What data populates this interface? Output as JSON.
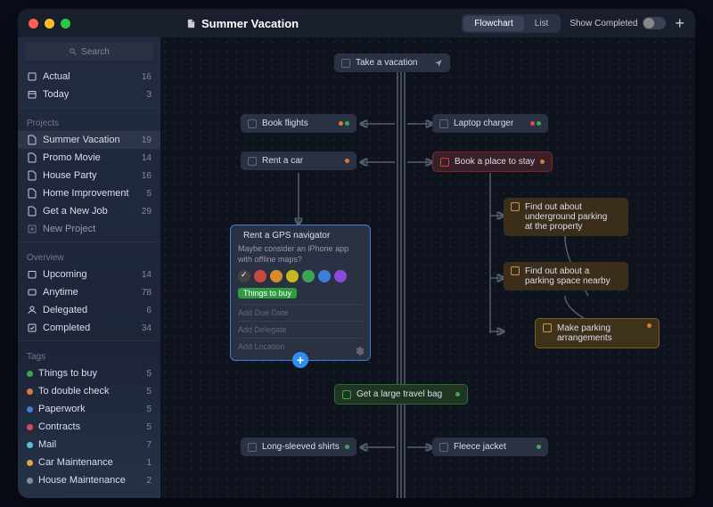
{
  "header": {
    "title": "Summer Vacation",
    "views": {
      "flowchart": "Flowchart",
      "list": "List"
    },
    "show_completed": "Show Completed"
  },
  "sidebar": {
    "search_placeholder": "Search",
    "favorites": [
      {
        "label": "Actual",
        "count": 16,
        "icon": "square"
      },
      {
        "label": "Today",
        "count": 3,
        "icon": "calendar"
      }
    ],
    "projects_header": "Projects",
    "projects": [
      {
        "label": "Summer Vacation",
        "count": 19,
        "selected": true
      },
      {
        "label": "Promo Movie",
        "count": 14
      },
      {
        "label": "House Party",
        "count": 16
      },
      {
        "label": "Home Improvement",
        "count": 5
      },
      {
        "label": "Get a New Job",
        "count": 29
      }
    ],
    "new_project_label": "New Project",
    "overview_header": "Overview",
    "overview": [
      {
        "label": "Upcoming",
        "count": 14,
        "icon": "calendar"
      },
      {
        "label": "Anytime",
        "count": 78,
        "icon": "box"
      },
      {
        "label": "Delegated",
        "count": 6,
        "icon": "person"
      },
      {
        "label": "Completed",
        "count": 34,
        "icon": "check"
      }
    ],
    "tags_header": "Tags",
    "tags": [
      {
        "label": "Things to buy",
        "count": 5,
        "color": "#3aa655"
      },
      {
        "label": "To double check",
        "count": 5,
        "color": "#d97840"
      },
      {
        "label": "Paperwork",
        "count": 5,
        "color": "#3a7fd9"
      },
      {
        "label": "Contracts",
        "count": 5,
        "color": "#d94a5a"
      },
      {
        "label": "Mail",
        "count": 7,
        "color": "#5ac0d0"
      },
      {
        "label": "Car Maintenance",
        "count": 1,
        "color": "#d9a840"
      },
      {
        "label": "House Maintenance",
        "count": 2,
        "color": "#8a8a9a"
      }
    ]
  },
  "nodes": {
    "take_vacation": {
      "label": "Take a vacation"
    },
    "book_flights": {
      "label": "Book flights",
      "dots": [
        "#d97840",
        "#3aa655"
      ]
    },
    "laptop_charger": {
      "label": "Laptop charger",
      "dots": [
        "#d94a5a",
        "#3aa655"
      ]
    },
    "rent_car": {
      "label": "Rent a car",
      "dots": [
        "#d97840"
      ]
    },
    "book_place": {
      "label": "Book a place to stay",
      "dots": [
        "#d97840"
      ]
    },
    "underground_parking": {
      "label_line1": "Find out about",
      "label_line2": "underground parking",
      "label_line3": "at the property"
    },
    "parking_nearby": {
      "label_line1": "Find out about a",
      "label_line2": "parking space nearby"
    },
    "parking_arr": {
      "label": "Make parking",
      "label_line2": "arrangements",
      "dots": [
        "#d97840"
      ]
    },
    "travel_bag": {
      "label": "Get a large travel bag",
      "dots": [
        "#3aa655"
      ]
    },
    "long_sleeved": {
      "label": "Long-sleeved shirts",
      "dots": [
        "#3aa655"
      ]
    },
    "fleece": {
      "label": "Fleece jacket",
      "dots": [
        "#3aa655"
      ]
    }
  },
  "editor": {
    "title": "Rent a GPS navigator",
    "desc": "Maybe consider an iPhone app with offline maps?",
    "colors": [
      "#444",
      "#c84a3a",
      "#d98a2a",
      "#c8b81f",
      "#3aa655",
      "#3a7fd9",
      "#8a4ad9"
    ],
    "selected_color_index": 0,
    "tag_chip": "Things to buy",
    "fields": [
      "Add Due Date",
      "Add Delegate",
      "Add Location"
    ]
  }
}
